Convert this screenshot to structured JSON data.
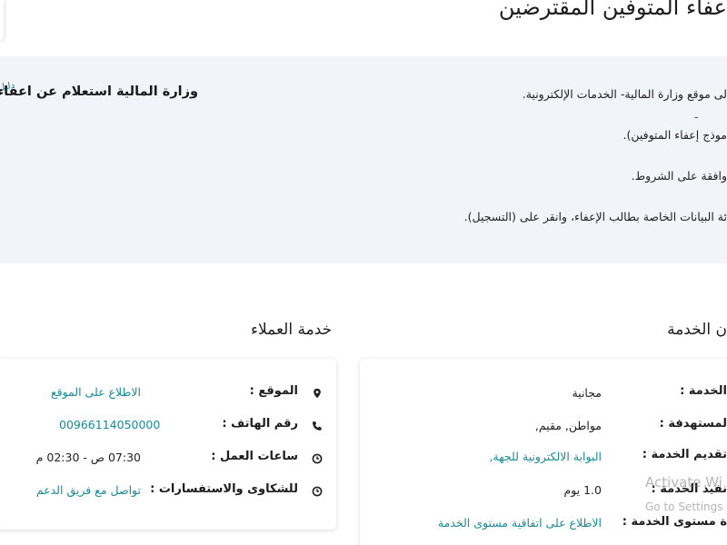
{
  "page": {
    "title": "عفاء المتوفين المقترضين"
  },
  "steps": {
    "items": [
      "لى موقع وزارة المالية- الخدمات الإلكترونية.",
      "موذج إعفاء المتوفين).",
      "وافقة على الشروط.",
      "ئة البيانات الخاصة بطالب الإعفاء، وانقر على (التسجيل)."
    ],
    "related_link": "وزارة المالية استعلام عن اعفاء",
    "related_accent": "دليل"
  },
  "customer_service": {
    "title": "خدمة العملاء",
    "rows": [
      {
        "label": "الموقع :",
        "value": "الاطلاع على الموقع",
        "icon": "location-pin-icon"
      },
      {
        "label": "رقم الهاتف :",
        "value": "00966114050000",
        "icon": "phone-icon"
      },
      {
        "label": "ساعات العمل :",
        "value": "07:30 ص - 02:30 م",
        "icon": "clock-icon"
      },
      {
        "label": "للشكاوى والاستفسارات :",
        "value": "تواصل مع فريق الدعم",
        "icon": "clock-icon"
      }
    ]
  },
  "service_info": {
    "title": "ن الخدمة",
    "rows": [
      {
        "label": "الخدمة :",
        "value": "مجانية"
      },
      {
        "label": "لمستهدفة :",
        "value": "مواطن, مقيم,"
      },
      {
        "label": "تقديم الخدمة :",
        "value": "البوابة الالكترونية للجهة,"
      },
      {
        "label": "نفيذ الخدمة :",
        "value": "1.0 يوم"
      },
      {
        "label": "ة مستوى الخدمة :",
        "value": "الاطلاع على اتفاقية مستوى الخدمة"
      }
    ]
  },
  "watermark": {
    "line1": "Activate Wi",
    "line2": "Go to Settings t"
  },
  "colors": {
    "link": "#1a8a96",
    "panel_bg": "#f1f4f8"
  }
}
